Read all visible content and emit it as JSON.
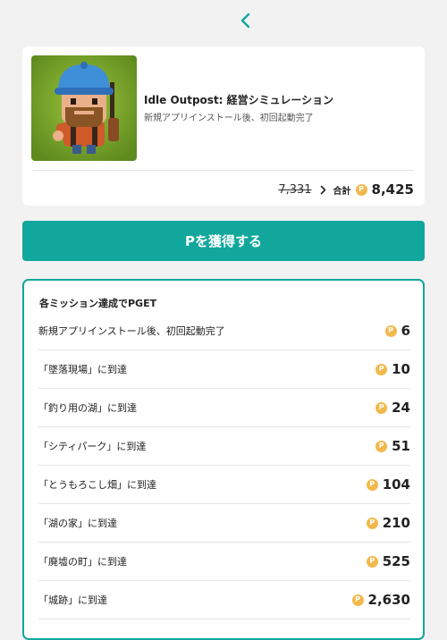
{
  "header": {
    "back_icon": "chevron-left-icon",
    "accent_color": "#12a79d"
  },
  "app": {
    "title": "Idle Outpost: 経営シミュレーション",
    "subtitle": "新規アプリインストール後、初回起動完了",
    "icon": "app-icon-bearded-character"
  },
  "totals": {
    "old_total": "7,331",
    "label": "合計",
    "coin_symbol": "P",
    "total": "8,425"
  },
  "get_button": {
    "label": "Pを獲得する"
  },
  "missions": {
    "header": "各ミッション達成でPGET",
    "items": [
      {
        "name": "新規アプリインストール後、初回起動完了",
        "points": "6"
      },
      {
        "name": "「墜落現場」に到達",
        "points": "10"
      },
      {
        "name": "「釣り用の湖」に到達",
        "points": "24"
      },
      {
        "name": "「シティパーク」に到達",
        "points": "51"
      },
      {
        "name": "「とうもろこし畑」に到達",
        "points": "104"
      },
      {
        "name": "「湖の家」に到達",
        "points": "210"
      },
      {
        "name": "「廃墟の町」に到達",
        "points": "525"
      },
      {
        "name": "「城跡」に到達",
        "points": "2,630"
      }
    ]
  }
}
